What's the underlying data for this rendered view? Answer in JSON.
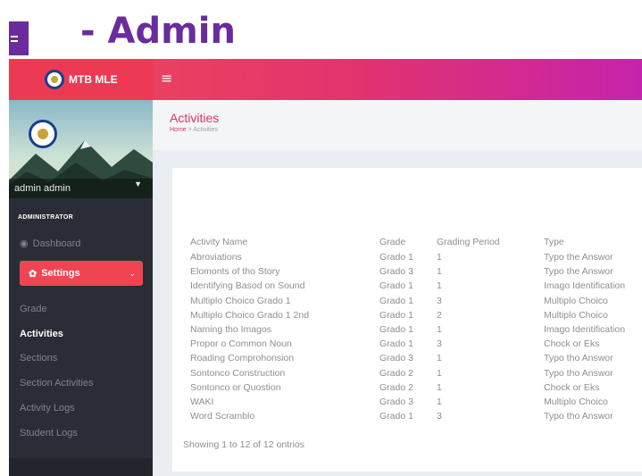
{
  "slide": {
    "title": "- Admin"
  },
  "brand": {
    "name": "MTB MLE",
    "menu_icon": "hamburger-icon"
  },
  "colors": {
    "accent": "#e0336a",
    "sidebar_bg": "#2a2d35",
    "slide_title": "#6a2c9c"
  },
  "sidebar": {
    "user": "admin admin",
    "section_header": "ADMINISTRATOR",
    "dashboard": "Dashboard",
    "settings": "Settings",
    "items": [
      "Grade",
      "Activities",
      "Sections",
      "Section Activities",
      "Activity Logs",
      "Student Logs"
    ],
    "active": "Activities"
  },
  "page": {
    "title": "Activities",
    "breadcrumb": {
      "home": "Home",
      "separator": ">",
      "current": "Activities"
    }
  },
  "table": {
    "headers": [
      "Activity Name",
      "Grade",
      "Grading Period",
      "Type"
    ],
    "rows": [
      [
        "Abroviations",
        "Grado 1",
        "1",
        "Typo the Answor"
      ],
      [
        "Elomonts of tho Story",
        "Grado 3",
        "1",
        "Typo the Answor"
      ],
      [
        "Identifying Basod on Sound",
        "Grado 1",
        "1",
        "Imago Identification"
      ],
      [
        "Multiplo Choico Grado 1",
        "Grado 1",
        "3",
        "Multiplo Choico"
      ],
      [
        "Multiplo Choico Grado 1 2nd",
        "Grado 1",
        "2",
        "Multiplo Choico"
      ],
      [
        "Naming tho Imagos",
        "Grado 1",
        "1",
        "Imago Identification"
      ],
      [
        "Propor o Common Noun",
        "Grado 1",
        "3",
        "Chock or Eks"
      ],
      [
        "Roading Comprohonsion",
        "Grado 3",
        "1",
        "Typo tho Answor"
      ],
      [
        "Sontonco Construction",
        "Grado 2",
        "1",
        "Typo tho Answor"
      ],
      [
        "Sontonco or Quostion",
        "Grado 2",
        "1",
        "Chock or Eks"
      ],
      [
        "WAKI",
        "Grado 3",
        "1",
        "Multiplo Choico"
      ],
      [
        "Word Scramblo",
        "Grado 1",
        "3",
        "Typo tho Answor"
      ]
    ],
    "footer": "Showing 1 to 12 of 12 ontrios"
  }
}
